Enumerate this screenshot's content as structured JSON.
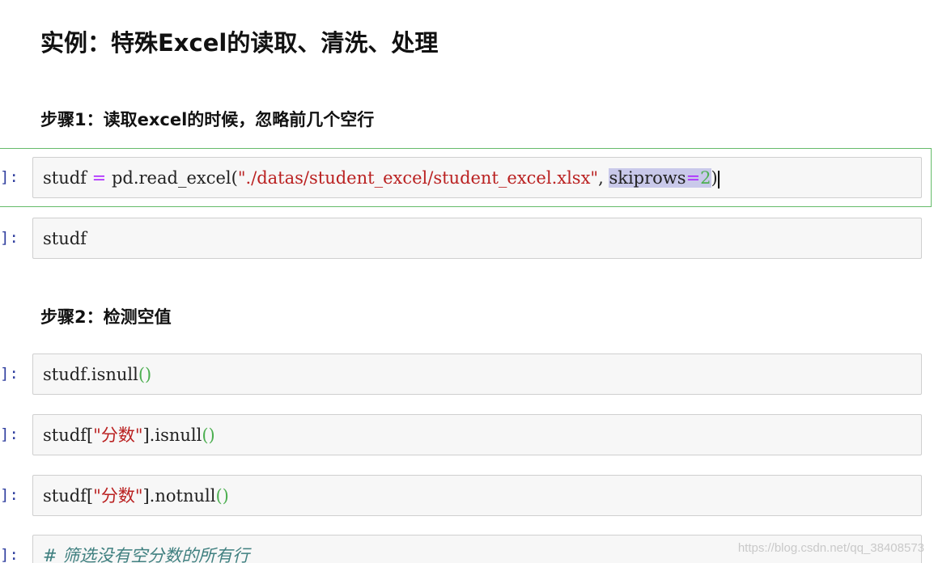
{
  "title": "实例：特殊Excel的读取、清洗、处理",
  "step1": "步骤1：读取excel的时候，忽略前几个空行",
  "step2": "步骤2：检测空值",
  "prompt": "]:",
  "cells": {
    "c1": {
      "var": "studf",
      "eq": "=",
      "func": "pd.read_excel(",
      "str": "\"./datas/student_excel/student_excel.xlsx\"",
      "comma": ", ",
      "kw": "skiprows",
      "kweq": "=",
      "num": "2",
      "close": ")"
    },
    "c2": {
      "text": "studf"
    },
    "c3": {
      "pre": "studf.isnull",
      "paren": "()"
    },
    "c4": {
      "pre": "studf[",
      "str": "\"分数\"",
      "mid": "].isnull",
      "paren": "()"
    },
    "c5": {
      "pre": "studf[",
      "str": "\"分数\"",
      "mid": "].notnull",
      "paren": "()"
    },
    "c6": {
      "comment": "# 筛选没有空分数的所有行"
    }
  },
  "watermark": "https://blog.csdn.net/qq_38408573"
}
